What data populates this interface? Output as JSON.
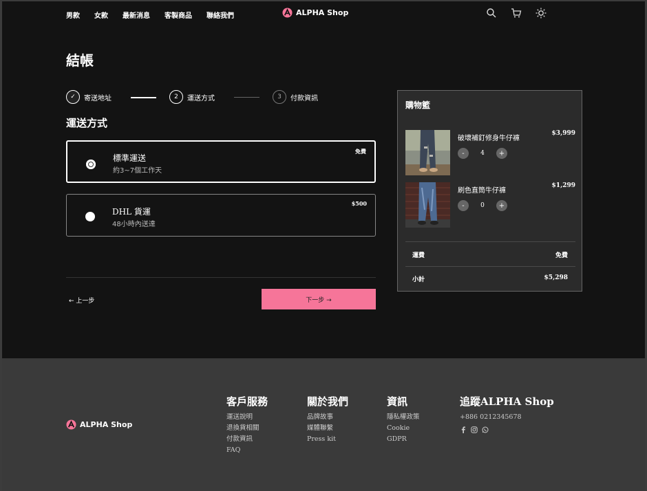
{
  "header": {
    "nav": [
      "男款",
      "女款",
      "最新消息",
      "客製商品",
      "聯絡我們"
    ],
    "brand": "ALPHA Shop"
  },
  "checkout": {
    "title": "結帳",
    "steps": [
      {
        "num": "✓",
        "label": "寄送地址"
      },
      {
        "num": "2",
        "label": "運送方式"
      },
      {
        "num": "3",
        "label": "付款資訊"
      }
    ],
    "section_title": "運送方式",
    "options": [
      {
        "name": "標準運送",
        "desc": "約3~7個工作天",
        "price": "免費",
        "selected": true
      },
      {
        "name": "DHL 貨運",
        "desc": "48小時內送達",
        "price": "$500",
        "selected": false
      }
    ],
    "prev_label": "← 上一步",
    "next_label": "下一步 →"
  },
  "cart": {
    "title": "購物籃",
    "items": [
      {
        "name": "破壞補釘修身牛仔褲",
        "price": "$3,999",
        "qty": "4"
      },
      {
        "name": "刷色直筒牛仔褲",
        "price": "$1,299",
        "qty": "0"
      }
    ],
    "shipping_label": "運費",
    "shipping_value": "免費",
    "subtotal_label": "小計",
    "subtotal_value": "$5,298"
  },
  "footer": {
    "brand": "ALPHA Shop",
    "columns": [
      {
        "title": "客戶服務",
        "links": [
          "運送說明",
          "退換貨相關",
          "付款資訊",
          "FAQ"
        ]
      },
      {
        "title": "關於我們",
        "links": [
          "品牌故事",
          "媒體聯繫",
          "Press kit"
        ]
      },
      {
        "title": "資訊",
        "links": [
          "隱私權政策",
          "Cookie",
          "GDPR"
        ]
      },
      {
        "title": "追蹤ALPHA Shop",
        "links": [
          "+886 0212345678"
        ]
      }
    ]
  },
  "colors": {
    "accent": "#f67599",
    "bg": "#131313",
    "footer_bg": "#3a3a3a"
  },
  "icons": [
    "search-icon",
    "cart-icon",
    "sun-icon",
    "facebook-icon",
    "instagram-icon",
    "whatsapp-icon"
  ]
}
